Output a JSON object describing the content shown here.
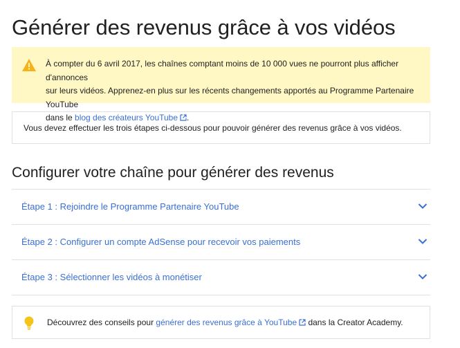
{
  "page": {
    "title": "Générer des revenus grâce à vos vidéos"
  },
  "warning": {
    "icon": "warning-icon",
    "color": "#f6b21b",
    "background": "#fff8c4",
    "text_line1": "À compter du 6 avril 2017, les chaînes comptant moins de 10 000 vues ne pourront plus afficher d'annonces",
    "text_line2": "sur leurs vidéos. Apprenez-en plus sur les récents changements apportés au Programme Partenaire YouTube",
    "text_prefix3": "dans le ",
    "link_label": "blog des créateurs YouTube",
    "text_suffix": "."
  },
  "info": {
    "text": "Vous devez effectuer les trois étapes ci-dessous pour pouvoir générer des revenus grâce à vos vidéos."
  },
  "setup": {
    "title": "Configurer votre chaîne pour générer des revenus",
    "steps": [
      {
        "label": "Étape 1 : Rejoindre le Programme Partenaire YouTube"
      },
      {
        "label": "Étape 2 : Configurer un compte AdSense pour recevoir vos paiements"
      },
      {
        "label": "Étape 3 : Sélectionner les vidéos à monétiser"
      }
    ]
  },
  "tip": {
    "icon": "lightbulb-icon",
    "color": "#f6c31b",
    "text_prefix": "Découvrez des conseils pour ",
    "link_label": "générer des revenus grâce à YouTube",
    "text_suffix": " dans la Creator Academy."
  },
  "colors": {
    "link": "#3a6fd4",
    "border": "#e0e0e0"
  }
}
